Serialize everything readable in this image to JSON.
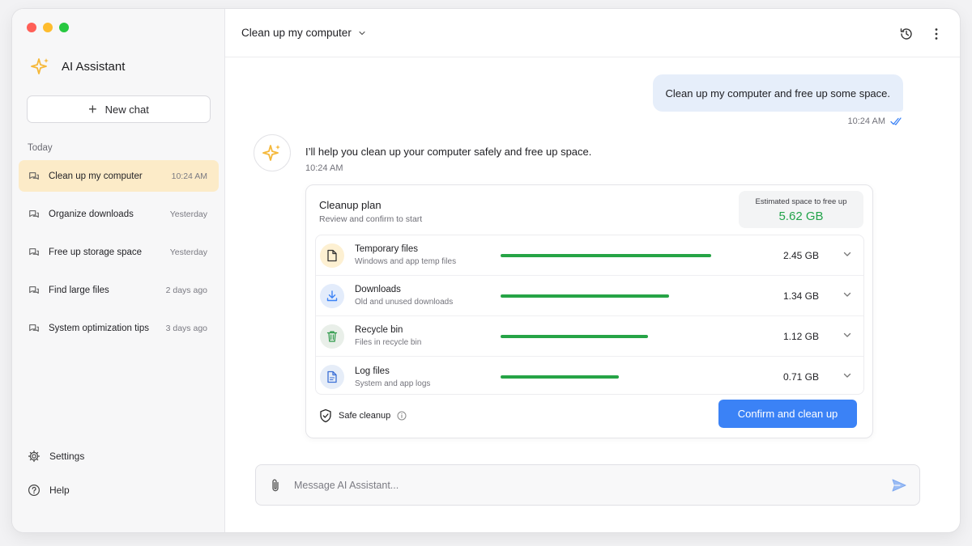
{
  "sidebar": {
    "brand_title": "AI Assistant",
    "new_chat_label": "New chat",
    "section_label": "Today",
    "conversations": [
      {
        "title": "Clean up my computer",
        "date": "10:24 AM",
        "active": true
      },
      {
        "title": "Organize downloads",
        "date": "Yesterday",
        "active": false
      },
      {
        "title": "Free up storage space",
        "date": "Yesterday",
        "active": false
      },
      {
        "title": "Find large files",
        "date": "2 days ago",
        "active": false
      },
      {
        "title": "System optimization tips",
        "date": "3 days ago",
        "active": false
      }
    ],
    "settings_label": "Settings",
    "help_label": "Help"
  },
  "header": {
    "chat_title": "Clean up my computer",
    "icons": [
      "history-icon",
      "more-vertical-icon"
    ]
  },
  "messages": {
    "user": {
      "text": "Clean up my computer and free up some space.",
      "time": "10:24 AM"
    },
    "assistant": {
      "text": "I’ll help you clean up your computer safely and free up space.",
      "time": "10:24 AM"
    }
  },
  "plan": {
    "title": "Cleanup plan",
    "subtitle": "Review and confirm to start",
    "estimate_label": "Estimated space to free up",
    "estimate_value": "5.62 GB",
    "items": [
      {
        "name": "Temporary files",
        "desc": "Windows and app temp files",
        "size": "2.45 GB",
        "icon": "file-icon",
        "fraction": 1.0
      },
      {
        "name": "Downloads",
        "desc": "Old and unused downloads",
        "size": "1.34 GB",
        "icon": "download-icon",
        "fraction": 0.8
      },
      {
        "name": "Recycle bin",
        "desc": "Files in recycle bin",
        "size": "1.12 GB",
        "icon": "trash-icon",
        "fraction": 0.7
      },
      {
        "name": "Log files",
        "desc": "System and app logs",
        "size": "0.71 GB",
        "icon": "log-file-icon",
        "fraction": 0.56
      }
    ],
    "safe_label": "Safe cleanup",
    "confirm_label": "Confirm and clean up"
  },
  "composer": {
    "placeholder": "Message AI Assistant..."
  },
  "colors": {
    "accent": "#3b82f6",
    "success": "#26a446",
    "active_conversation": "#fcebc8",
    "brand_star": "#f5b83a"
  }
}
